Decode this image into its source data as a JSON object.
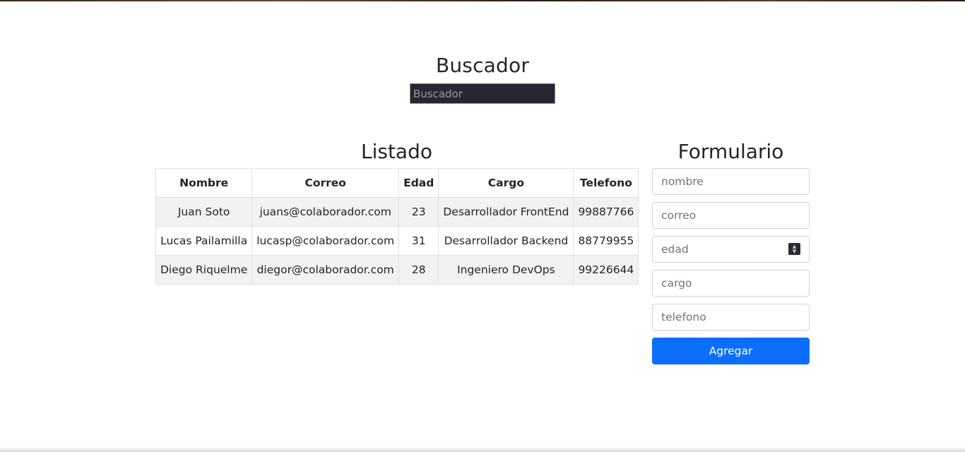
{
  "search": {
    "title": "Buscador",
    "placeholder": "Buscador",
    "value": ""
  },
  "listado": {
    "title": "Listado",
    "columns": [
      "Nombre",
      "Correo",
      "Edad",
      "Cargo",
      "Telefono"
    ],
    "rows": [
      [
        "Juan Soto",
        "juans@colaborador.com",
        "23",
        "Desarrollador FrontEnd",
        "99887766"
      ],
      [
        "Lucas Pailamilla",
        "lucasp@colaborador.com",
        "31",
        "Desarrollador Backend",
        "88779955"
      ],
      [
        "Diego Riquelme",
        "diegor@colaborador.com",
        "28",
        "Ingeniero DevOps",
        "99226644"
      ]
    ]
  },
  "formulario": {
    "title": "Formulario",
    "fields": {
      "nombre": {
        "placeholder": "nombre",
        "value": ""
      },
      "correo": {
        "placeholder": "correo",
        "value": ""
      },
      "edad": {
        "placeholder": "edad",
        "value": ""
      },
      "cargo": {
        "placeholder": "cargo",
        "value": ""
      },
      "telefono": {
        "placeholder": "telefono",
        "value": ""
      }
    },
    "submit_label": "Agregar"
  },
  "colors": {
    "primary": "#0d6efd",
    "search_bg": "#272631",
    "stripe": "#f2f2f2",
    "border": "#dee2e6"
  },
  "icons": {
    "spinner": "number-spinner-icon"
  }
}
